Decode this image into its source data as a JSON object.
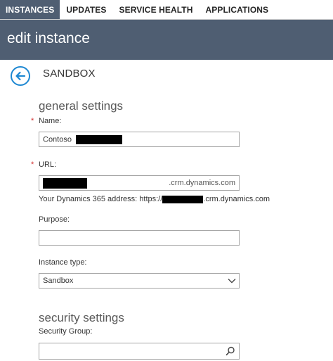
{
  "tabs": [
    {
      "label": "INSTANCES",
      "active": true
    },
    {
      "label": "UPDATES",
      "active": false
    },
    {
      "label": "SERVICE HEALTH",
      "active": false
    },
    {
      "label": "APPLICATIONS",
      "active": false
    }
  ],
  "header": {
    "title": "edit instance"
  },
  "instance": {
    "name": "SANDBOX"
  },
  "general": {
    "title": "general settings",
    "required_mark": "*",
    "name_label": "Name:",
    "name_value": "Contoso",
    "url_label": "URL:",
    "url_suffix": ".crm.dynamics.com",
    "address_prefix": "Your Dynamics 365 address: https://",
    "address_suffix": ".crm.dynamics.com",
    "purpose_label": "Purpose:",
    "purpose_value": "",
    "type_label": "Instance type:",
    "type_value": "Sandbox"
  },
  "security": {
    "title": "security settings",
    "group_label": "Security Group:",
    "group_value": ""
  },
  "colors": {
    "header_bg": "#4f5e72",
    "accent": "#1e88d2",
    "required": "#d32f2f"
  },
  "icons": [
    "back-arrow-icon",
    "chevron-down-icon",
    "search-icon"
  ]
}
